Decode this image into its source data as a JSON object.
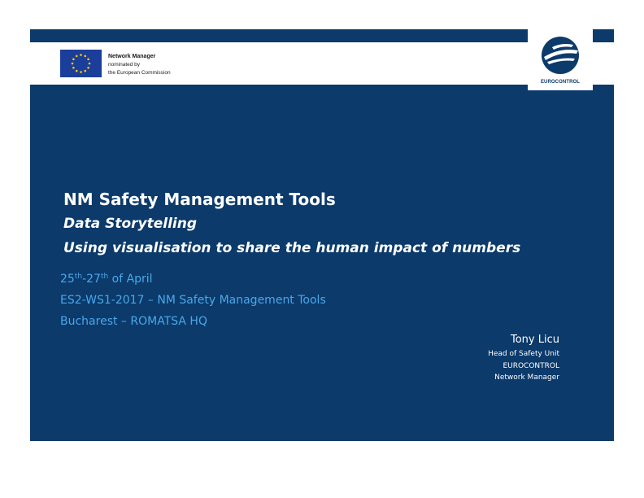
{
  "header": {
    "nm_title": "Network Manager",
    "nm_line1": "nominated by",
    "nm_line2": "the European Commission",
    "logo_text": "EUROCONTROL"
  },
  "title": {
    "main": "NM Safety Management Tools",
    "sub1": "Data Storytelling",
    "sub2": "Using visualisation to share the human impact of numbers"
  },
  "info": {
    "date_day1": "25",
    "date_sup1": "th",
    "date_sep": "-27",
    "date_sup2": "th",
    "date_rest": " of April",
    "event": "ES2-WS1-2017 – NM Safety Management Tools",
    "location": "Bucharest – ROMATSA HQ"
  },
  "presenter": {
    "name": "Tony Licu",
    "role": "Head of Safety Unit",
    "org": "EUROCONTROL",
    "dept": "Network Manager"
  },
  "colors": {
    "slide_background": "#0b3a6b",
    "info_text": "#4aa8e8",
    "eu_flag": "#1b3e9a",
    "eu_stars": "#ffcc00"
  }
}
